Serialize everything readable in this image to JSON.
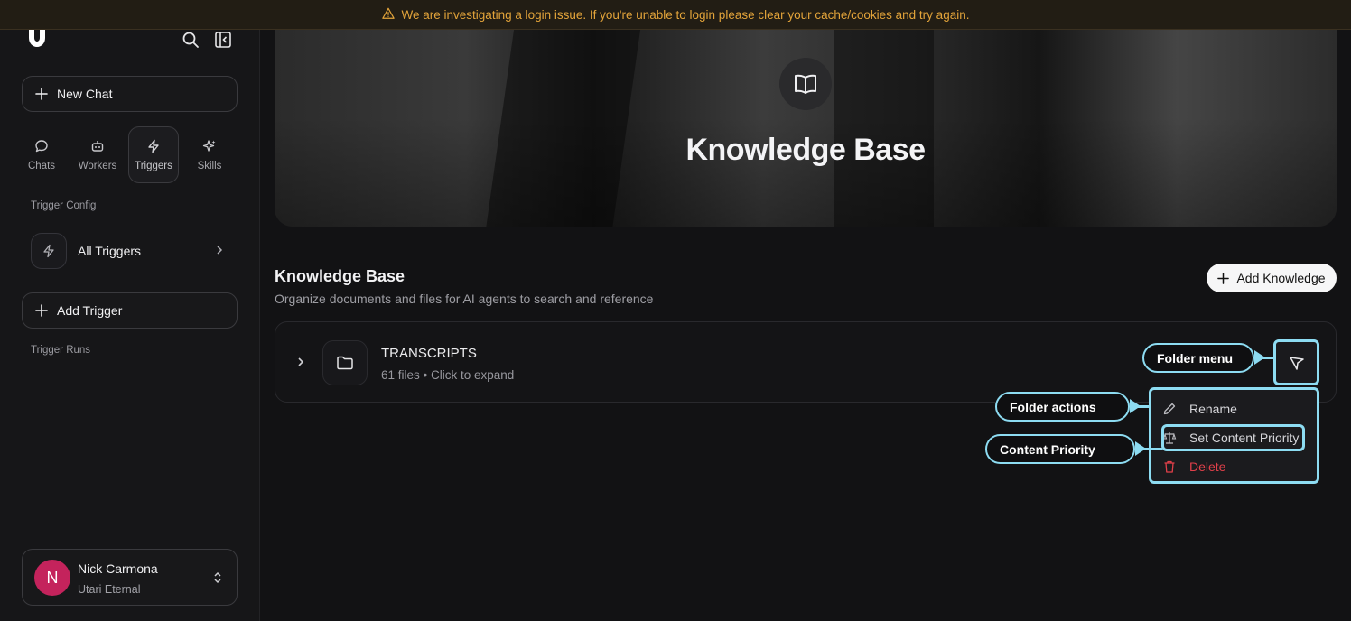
{
  "banner": {
    "text": "We are investigating a login issue. If you're unable to login please clear your cache/cookies and try again."
  },
  "sidebar": {
    "new_chat_label": "New Chat",
    "tabs": [
      {
        "label": "Chats",
        "icon": "chat-bubble-icon"
      },
      {
        "label": "Workers",
        "icon": "robot-icon"
      },
      {
        "label": "Triggers",
        "icon": "lightning-icon"
      },
      {
        "label": "Skills",
        "icon": "sparkles-icon"
      }
    ],
    "trigger_config_label": "Trigger Config",
    "all_triggers_label": "All Triggers",
    "add_trigger_label": "Add Trigger",
    "trigger_runs_label": "Trigger Runs"
  },
  "user": {
    "initial": "N",
    "name": "Nick Carmona",
    "org": "Utari Eternal",
    "avatar_color": "#c4235c"
  },
  "hero": {
    "title": "Knowledge Base"
  },
  "main": {
    "title": "Knowledge Base",
    "subtitle": "Organize documents and files for AI agents to search and reference",
    "add_knowledge_label": "Add Knowledge"
  },
  "folder": {
    "name": "TRANSCRIPTS",
    "meta": "61 files • Click to expand"
  },
  "menu": {
    "items": [
      {
        "label": "Rename",
        "icon": "pencil-icon"
      },
      {
        "label": "Set Content Priority",
        "icon": "scale-icon"
      },
      {
        "label": "Delete",
        "icon": "trash-icon"
      }
    ]
  },
  "callouts": {
    "folder_menu": "Folder menu",
    "folder_actions": "Folder actions",
    "content_priority": "Content Priority"
  },
  "colors": {
    "accent": "#8ddcf2",
    "warning": "#e3a43a",
    "danger": "#e2404a"
  }
}
